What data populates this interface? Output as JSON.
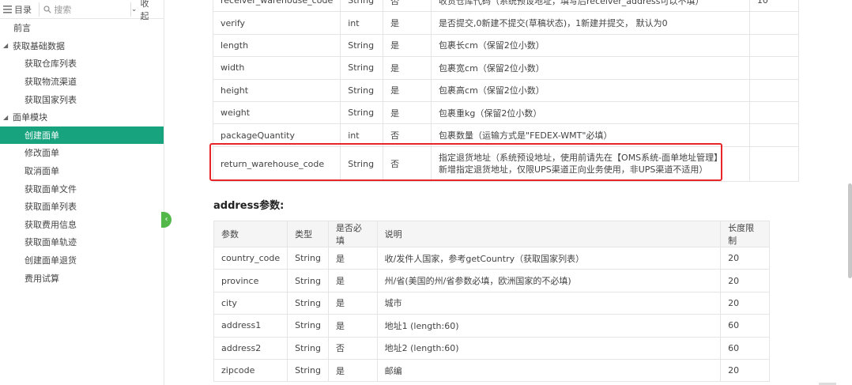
{
  "sidebar": {
    "toc_label": "目录",
    "search_placeholder": "搜索",
    "collapse_label": "收起",
    "items": [
      {
        "label": "前言",
        "level": 0,
        "group": false
      },
      {
        "label": "获取基础数据",
        "level": 0,
        "group": true
      },
      {
        "label": "获取仓库列表",
        "level": 1
      },
      {
        "label": "获取物流渠道",
        "level": 1
      },
      {
        "label": "获取国家列表",
        "level": 1
      },
      {
        "label": "面单模块",
        "level": 0,
        "group": true
      },
      {
        "label": "创建面单",
        "level": 1,
        "active": true
      },
      {
        "label": "修改面单",
        "level": 1
      },
      {
        "label": "取消面单",
        "level": 1
      },
      {
        "label": "获取面单文件",
        "level": 1
      },
      {
        "label": "获取面单列表",
        "level": 1
      },
      {
        "label": "获取费用信息",
        "level": 1
      },
      {
        "label": "获取面单轨迹",
        "level": 1
      },
      {
        "label": "创建面单退货",
        "level": 1
      },
      {
        "label": "费用试算",
        "level": 1
      }
    ]
  },
  "params_table": {
    "rows": [
      [
        "receiver_warehouse_code",
        "String",
        "否",
        "收货仓库代码（系统预设地址，填写后receiver_address可以不填）",
        "10"
      ],
      [
        "verify",
        "int",
        "是",
        "是否提交,0新建不提交(草稿状态)，1新建并提交， 默认为0",
        ""
      ],
      [
        "length",
        "String",
        "是",
        "包裹长cm（保留2位小数）",
        ""
      ],
      [
        "width",
        "String",
        "是",
        "包裹宽cm（保留2位小数）",
        ""
      ],
      [
        "height",
        "String",
        "是",
        "包裹高cm（保留2位小数）",
        ""
      ],
      [
        "weight",
        "String",
        "是",
        "包裹重kg（保留2位小数）",
        ""
      ],
      [
        "packageQuantity",
        "int",
        "否",
        "包裹数量（运输方式是\"FEDEX-WMT\"必填）",
        ""
      ]
    ],
    "highlight_row": {
      "name": "return_warehouse_code",
      "type": "String",
      "required": "否",
      "desc_line1": "指定退货地址（系统预设地址，使用前请先在【OMS系统-面单地址管理】",
      "desc_line2": "新增指定退货地址，仅限UPS渠道正向业务使用，非UPS渠道不适用）",
      "limit": ""
    }
  },
  "address_section": {
    "title": "address参数:",
    "headers": [
      "参数",
      "类型",
      "是否必填",
      "说明",
      "长度限制"
    ],
    "rows": [
      [
        "country_code",
        "String",
        "是",
        "收/发件人国家，参考getCountry（获取国家列表）",
        "20"
      ],
      [
        "province",
        "String",
        "是",
        "州/省(美国的州/省参数必填，欧洲国家的不必填)",
        "20"
      ],
      [
        "city",
        "String",
        "是",
        "城市",
        "20"
      ],
      [
        "address1",
        "String",
        "是",
        "地址1 (length:60)",
        "60"
      ],
      [
        "address2",
        "String",
        "否",
        "地址2 (length:60)",
        "60"
      ],
      [
        "zipcode",
        "String",
        "是",
        "邮编",
        "20"
      ]
    ]
  },
  "colors": {
    "active_bg": "#17a37e",
    "highlight_border": "#e8262a",
    "toggle_bg": "#52b84a"
  }
}
